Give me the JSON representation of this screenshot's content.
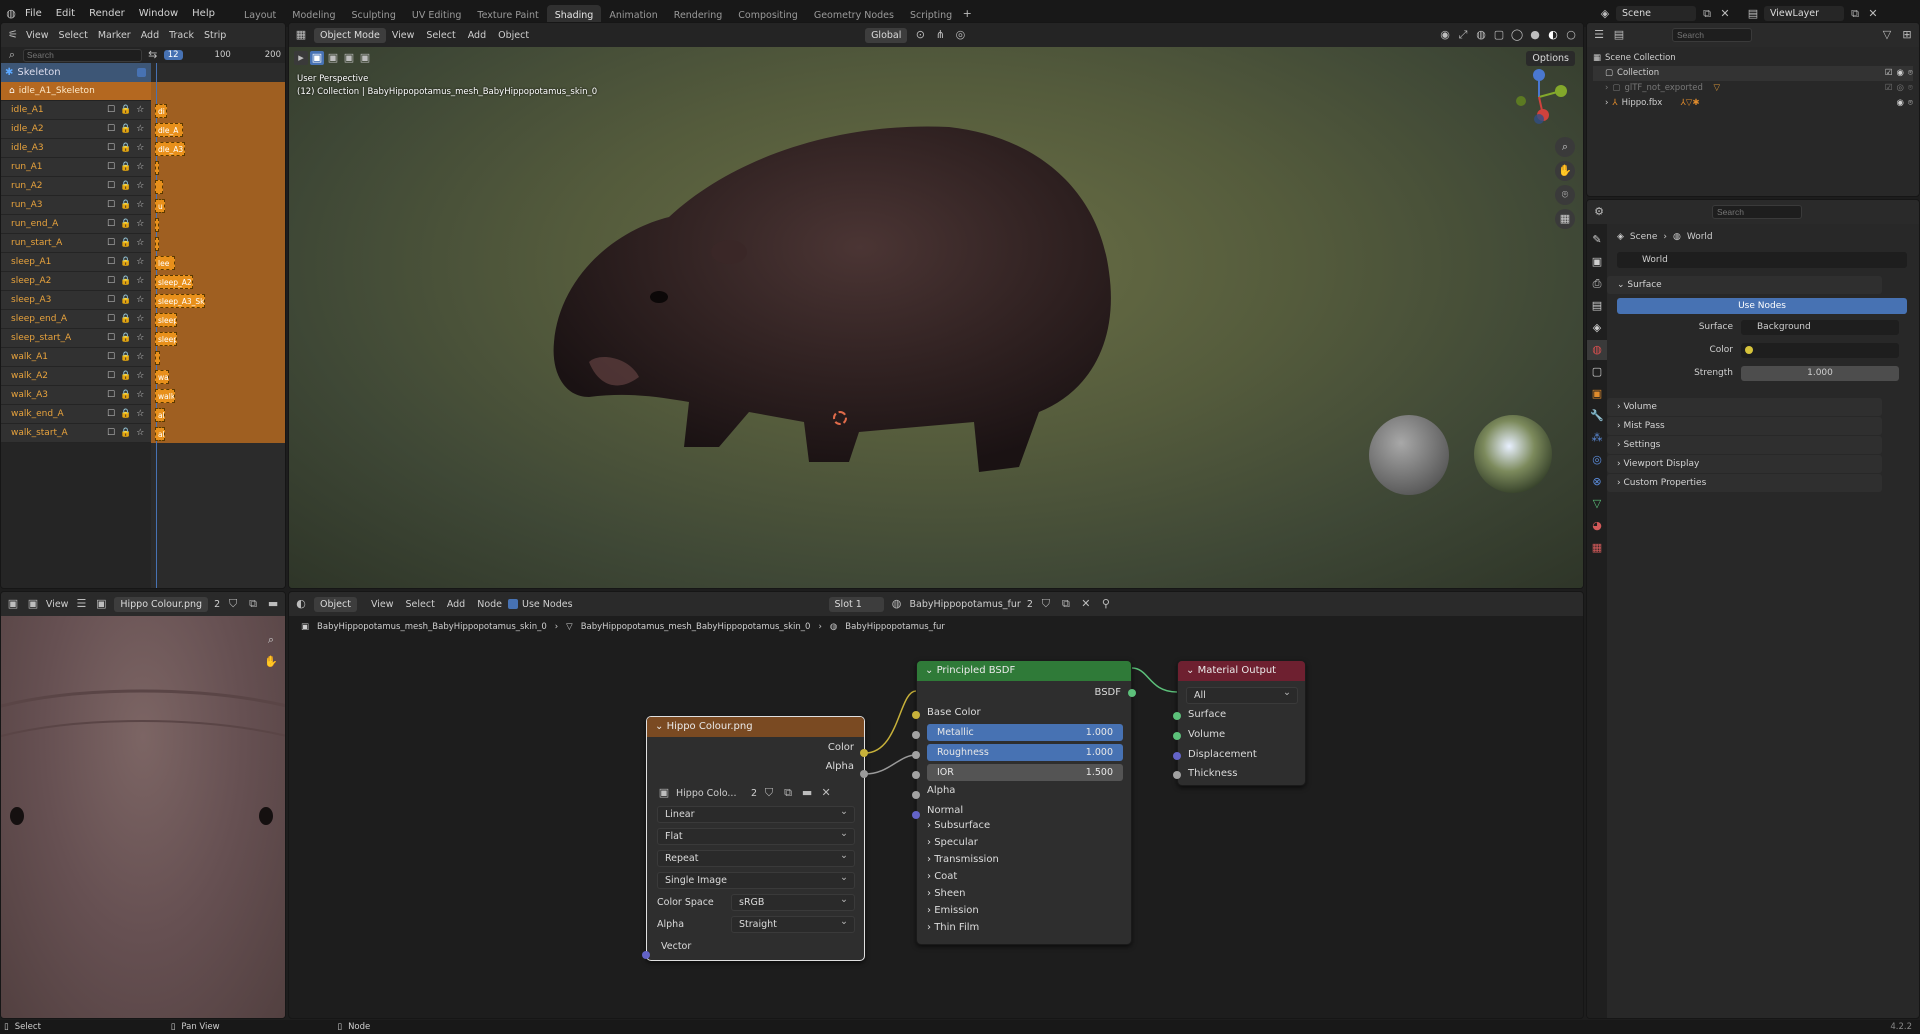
{
  "menu": [
    "File",
    "Edit",
    "Render",
    "Window",
    "Help"
  ],
  "workspaces": [
    "Layout",
    "Modeling",
    "Sculpting",
    "UV Editing",
    "Texture Paint",
    "Shading",
    "Animation",
    "Rendering",
    "Compositing",
    "Geometry Nodes",
    "Scripting"
  ],
  "active_workspace": "Shading",
  "scene": "Scene",
  "view_layer": "ViewLayer",
  "dope": {
    "menus": [
      "View",
      "Select",
      "Marker",
      "Add",
      "Track",
      "Strip"
    ],
    "search_placeholder": "Search",
    "frame_current": "12",
    "frame_ticks": [
      "100",
      "200"
    ],
    "skeleton": "Skeleton",
    "skeleton_child": "idle_A1_Skeleton",
    "tracks": [
      {
        "name": "idle_A1",
        "key": "di",
        "w": 12
      },
      {
        "name": "idle_A2",
        "key": "dle_A",
        "w": 28
      },
      {
        "name": "idle_A3",
        "key": "dle_A3",
        "w": 30
      },
      {
        "name": "run_A1",
        "key": "",
        "w": 4
      },
      {
        "name": "run_A2",
        "key": "",
        "w": 8
      },
      {
        "name": "run_A3",
        "key": "u",
        "w": 10
      },
      {
        "name": "run_end_A",
        "key": "",
        "w": 4
      },
      {
        "name": "run_start_A",
        "key": "",
        "w": 4
      },
      {
        "name": "sleep_A1",
        "key": "lee",
        "w": 20
      },
      {
        "name": "sleep_A2",
        "key": "sleep_A2",
        "w": 38
      },
      {
        "name": "sleep_A3",
        "key": "sleep_A3_Ske",
        "w": 50
      },
      {
        "name": "sleep_end_A",
        "key": "sleep",
        "w": 22
      },
      {
        "name": "sleep_start_A",
        "key": "sleep",
        "w": 22
      },
      {
        "name": "walk_A1",
        "key": "",
        "w": 5
      },
      {
        "name": "walk_A2",
        "key": "wa",
        "w": 14
      },
      {
        "name": "walk_A3",
        "key": "walk",
        "w": 20
      },
      {
        "name": "walk_end_A",
        "key": "al",
        "w": 10
      },
      {
        "name": "walk_start_A",
        "key": "al",
        "w": 10
      }
    ]
  },
  "viewport": {
    "mode": "Object Mode",
    "menus": [
      "View",
      "Select",
      "Add",
      "Object"
    ],
    "transform": "Global",
    "options": "Options",
    "overlay_line1": "User Perspective",
    "overlay_line2": "(12) Collection | BabyHippopotamus_mesh_BabyHippopotamus_skin_0"
  },
  "image_editor": {
    "view": "View",
    "image": "Hippo Colour.png",
    "users": "2"
  },
  "node_editor": {
    "type": "Object",
    "menus": [
      "View",
      "Select",
      "Add",
      "Node"
    ],
    "use_nodes": "Use Nodes",
    "slot": "Slot 1",
    "material": "BabyHippopotamus_fur",
    "users": "2",
    "breadcrumb": [
      "BabyHippopotamus_mesh_BabyHippopotamus_skin_0",
      "BabyHippopotamus_mesh_BabyHippopotamus_skin_0",
      "BabyHippopotamus_fur"
    ],
    "image_node": {
      "title": "Hippo Colour.png",
      "out_color": "Color",
      "out_alpha": "Alpha",
      "image": "Hippo Colo...",
      "users": "2",
      "interp": "Linear",
      "proj": "Flat",
      "ext": "Repeat",
      "source": "Single Image",
      "cs_label": "Color Space",
      "cs": "sRGB",
      "alpha_label": "Alpha",
      "alpha": "Straight",
      "vector": "Vector"
    },
    "bsdf": {
      "title": "Principled BSDF",
      "out": "BSDF",
      "base": "Base Color",
      "metallic": "Metallic",
      "metallic_v": "1.000",
      "rough": "Roughness",
      "rough_v": "1.000",
      "ior": "IOR",
      "ior_v": "1.500",
      "alpha": "Alpha",
      "normal": "Normal",
      "panels": [
        "Subsurface",
        "Specular",
        "Transmission",
        "Coat",
        "Sheen",
        "Emission",
        "Thin Film"
      ]
    },
    "output": {
      "title": "Material Output",
      "target": "All",
      "surface": "Surface",
      "volume": "Volume",
      "disp": "Displacement",
      "thick": "Thickness"
    }
  },
  "outliner": {
    "search_placeholder": "Search",
    "items": [
      "Scene Collection",
      "Collection",
      "glTF_not_exported",
      "Hippo.fbx"
    ]
  },
  "props": {
    "search_placeholder": "Search",
    "crumb_scene": "Scene",
    "crumb_world": "World",
    "world_name": "World",
    "surface_section": "Surface",
    "use_nodes": "Use Nodes",
    "surface_label": "Surface",
    "surface_val": "Background",
    "color_label": "Color",
    "strength_label": "Strength",
    "strength_val": "1.000",
    "sections": [
      "Volume",
      "Mist Pass",
      "Settings",
      "Viewport Display",
      "Custom Properties"
    ]
  },
  "status": {
    "select": "Select",
    "pan": "Pan View",
    "node": "Node",
    "version": "4.2.2"
  }
}
